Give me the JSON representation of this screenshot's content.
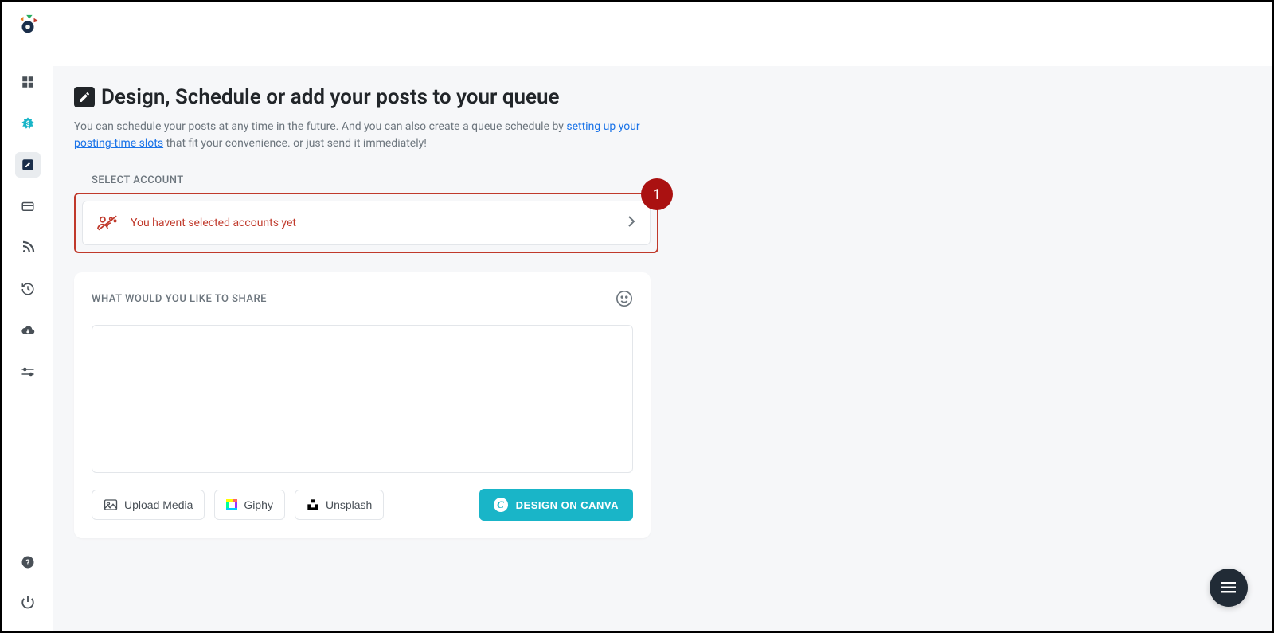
{
  "header": {
    "title": "Design, Schedule or add your posts to your queue",
    "desc_before": "You can schedule your posts at any time in the future. And you can also create a queue schedule by ",
    "desc_link": "setting up your posting-time slots",
    "desc_after": " that fit your convenience. or just send it immediately!"
  },
  "account_section": {
    "label": "SELECT ACCOUNT",
    "empty_text": "You havent selected accounts yet",
    "badge": "1"
  },
  "share": {
    "label": "WHAT WOULD YOU LIKE TO SHARE",
    "textarea_value": "",
    "upload_label": "Upload Media",
    "giphy_label": "Giphy",
    "unsplash_label": "Unsplash",
    "canva_label": "DESIGN ON CANVA"
  },
  "sidebar": {
    "items": [
      "dashboard",
      "pricing",
      "compose",
      "queue",
      "rss",
      "history",
      "downloads",
      "settings"
    ],
    "bottom": [
      "help",
      "power"
    ]
  }
}
